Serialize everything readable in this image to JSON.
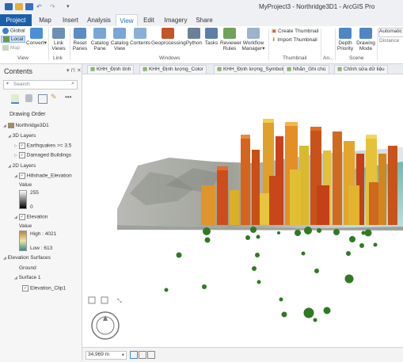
{
  "window": {
    "title": "MyProject3 - Northridge3D1 - ArcGIS Pro"
  },
  "tabs": [
    "Project",
    "Map",
    "Insert",
    "Analysis",
    "View",
    "Edit",
    "Imagery",
    "Share"
  ],
  "active_tab": "View",
  "ribbon": {
    "view_group": {
      "global": "Global",
      "local": "Local",
      "map": "Map",
      "convert": "Convert",
      "label": "View"
    },
    "link_group": {
      "link_views": "Link Views",
      "label": "Link"
    },
    "windows_group": {
      "reset_panes": "Reset Panes",
      "catalog_pane": "Catalog Pane",
      "catalog_view": "Catalog View",
      "contents": "Contents",
      "geoprocessing": "Geoprocessing",
      "python": "Python",
      "tasks": "Tasks",
      "reviewer_rules": "Reviewer Rules",
      "workflow_manager": "Workflow Manager",
      "label": "Windows"
    },
    "thumbnail_group": {
      "create": "Create Thumbnail",
      "import": "Import Thumbnail",
      "label": "Thumbnail"
    },
    "an_label": "An...",
    "scene_group": {
      "depth_priority": "Depth Priority",
      "drawing_mode": "Drawing Mode",
      "label": "Scene"
    },
    "nav_group": {
      "automatic": "Automatic",
      "distance": "Distance"
    }
  },
  "contents_pane": {
    "title": "Contents",
    "search_placeholder": "Search",
    "drawing_order": "Drawing Order",
    "map_name": "Northridge3D1",
    "layers_3d": "3D Layers",
    "earthquakes": "Earthquakes >= 3.5",
    "damaged": "Damaged Buildings",
    "layers_2d": "2D Layers",
    "hillshade": "Hillshade_Elevation",
    "value_label": "Value",
    "hs_high": "255",
    "hs_low": "0",
    "elevation": "Elevation",
    "elev_value_label": "Value",
    "elev_high": "High : 4021",
    "elev_low": "Low : 613",
    "elevation_surfaces": "Elevation Surfaces",
    "ground": "Ground",
    "surface1": "Surface 1",
    "clip": "Elevation_Clip1"
  },
  "map_tabs": [
    "KHH_Định tính",
    "KHH_Định lượng_Color",
    "KHH_Định lượng_Symbols",
    "Nhãn_Ghi chú",
    "Chỉnh sửa dữ liệu"
  ],
  "status": {
    "scale": "34,969 m"
  },
  "colors": {
    "project_blue": "#1a5fa8",
    "accent": "#2a6ebb",
    "earthquake_green": "#2f7a22"
  }
}
